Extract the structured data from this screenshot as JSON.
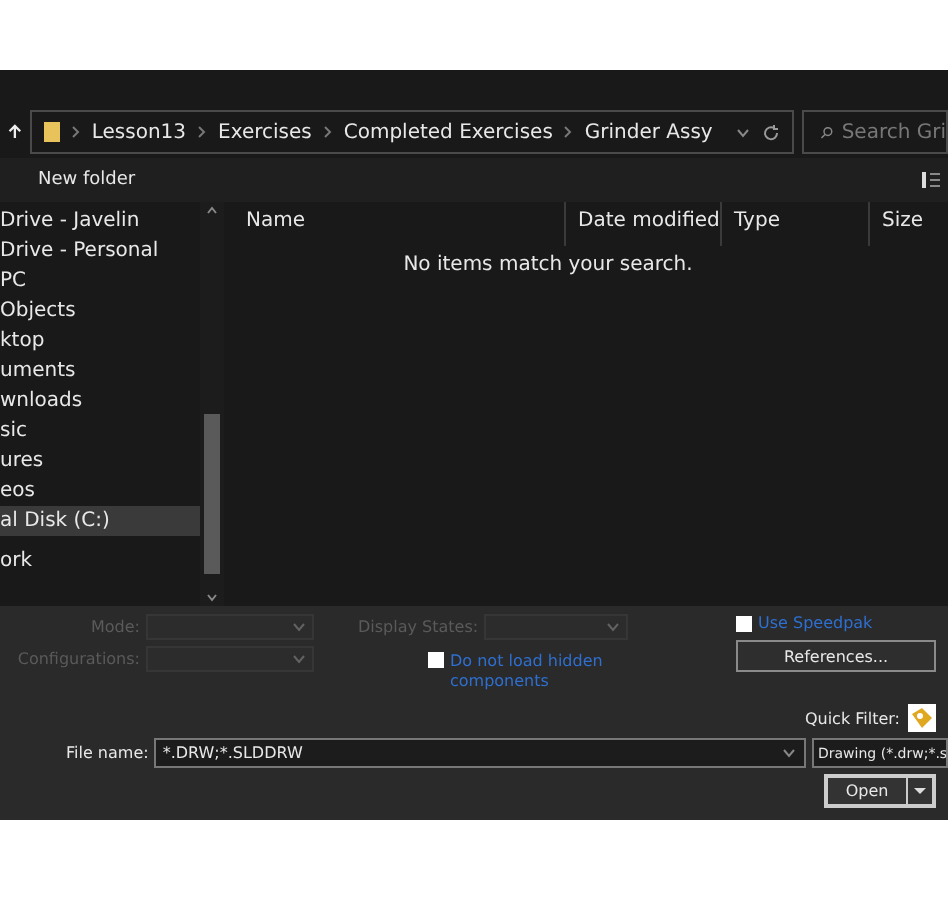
{
  "address_bar": {
    "path": [
      "Lesson13",
      "Exercises",
      "Completed Exercises",
      "Grinder Assy"
    ]
  },
  "search": {
    "placeholder": "Search Gri"
  },
  "toolbar": {
    "new_folder": "New folder"
  },
  "sidebar": {
    "items": [
      {
        "label": "Drive - Javelin",
        "selected": false
      },
      {
        "label": "Drive - Personal",
        "selected": false
      },
      {
        "label": "PC",
        "selected": false
      },
      {
        "label": "Objects",
        "selected": false
      },
      {
        "label": "ktop",
        "selected": false
      },
      {
        "label": "uments",
        "selected": false
      },
      {
        "label": "wnloads",
        "selected": false
      },
      {
        "label": "sic",
        "selected": false
      },
      {
        "label": "ures",
        "selected": false
      },
      {
        "label": "eos",
        "selected": false
      },
      {
        "label": "al Disk (C:)",
        "selected": true
      },
      {
        "label": "ork",
        "selected": false
      }
    ]
  },
  "table": {
    "columns": [
      "Name",
      "Date modified",
      "Type",
      "Size"
    ],
    "empty_message": "No items match your search."
  },
  "options": {
    "mode": {
      "label": "Mode:",
      "disabled": true
    },
    "configurations": {
      "label": "Configurations:",
      "disabled": true
    },
    "display_states": {
      "label": "Display States:",
      "disabled": true
    },
    "hidden_components": {
      "label": "Do not load hidden components",
      "checked": false
    },
    "speedpak": {
      "label": "Use Speedpak",
      "checked": false
    },
    "references": "References...",
    "quick_filter": "Quick Filter:"
  },
  "file_name": {
    "label": "File name:",
    "value": "*.DRW;*.SLDDRW"
  },
  "file_type": {
    "value": "Drawing (*.drw;*.s"
  },
  "open_button": "Open"
}
